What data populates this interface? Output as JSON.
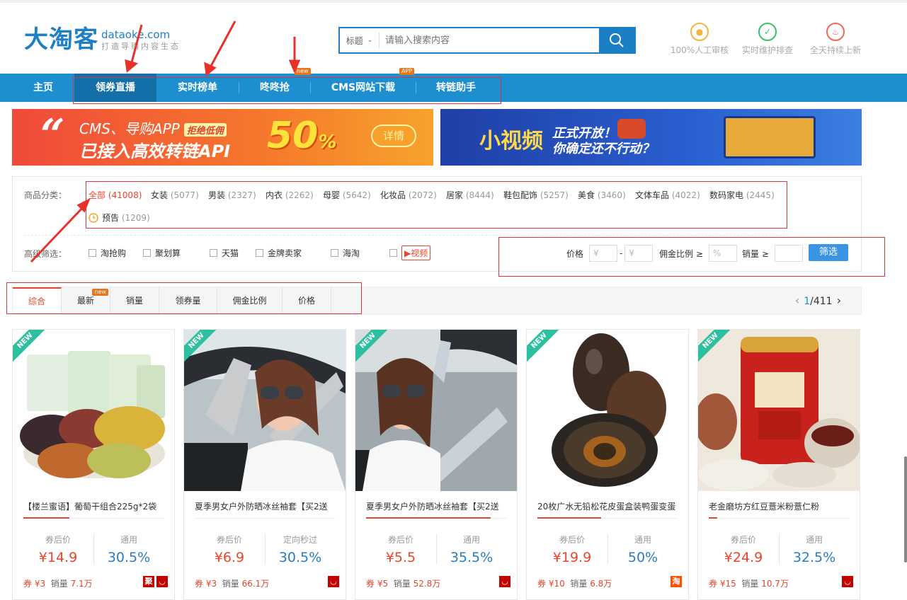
{
  "logo": {
    "cn": "大淘客",
    "en": "dataoke.com",
    "slogan": "打造导购内容生态"
  },
  "search": {
    "category": "标题",
    "placeholder": "请输入搜索内容"
  },
  "badges": [
    {
      "label": "100%人工审核",
      "icon": "person-icon",
      "color": "#f5b342"
    },
    {
      "label": "实时维护排查",
      "icon": "shield-check-icon",
      "color": "#3cbf6a"
    },
    {
      "label": "全天持续上新",
      "icon": "flame-icon",
      "color": "#ef6a55"
    }
  ],
  "nav": {
    "items": [
      "主页",
      "领券直播",
      "实时榜单",
      "咚咚抢",
      "CMS网站下载",
      "转链助手"
    ],
    "tag_new": "new",
    "tag_app": "APP"
  },
  "banner1": {
    "line1": "CMS、导购APP",
    "tag": "拒绝低佣",
    "line2": "已接入高效转链API",
    "percent": "50",
    "percent_sign": "%",
    "button": "详情"
  },
  "banner2": {
    "title": "小视频",
    "sub1": "正式开放！",
    "sub2": "你确定还不行动？"
  },
  "filter": {
    "category_label": "商品分类：",
    "categories": [
      {
        "name": "全部",
        "count": "(41008)"
      },
      {
        "name": "女装",
        "count": "(5077)"
      },
      {
        "name": "男装",
        "count": "(2327)"
      },
      {
        "name": "内衣",
        "count": "(2262)"
      },
      {
        "name": "母婴",
        "count": "(5642)"
      },
      {
        "name": "化妆品",
        "count": "(2072)"
      },
      {
        "name": "居家",
        "count": "(8444)"
      },
      {
        "name": "鞋包配饰",
        "count": "(5257)"
      },
      {
        "name": "美食",
        "count": "(3460)"
      },
      {
        "name": "文体车品",
        "count": "(4022)"
      },
      {
        "name": "数码家电",
        "count": "(2445)"
      },
      {
        "name": "预告",
        "count": "(1209)"
      }
    ],
    "advanced_label": "高级筛选：",
    "checks": [
      "淘抢购",
      "聚划算",
      "天猫",
      "金牌卖家",
      "海淘",
      "视频"
    ],
    "price_label": "价格",
    "currency": "¥",
    "dash": "-",
    "commission_label": "佣金比例 ≥",
    "percent": "%",
    "sales_label": "销量 ≥",
    "button": "筛选"
  },
  "sort": {
    "tabs": [
      "综合",
      "最新",
      "销量",
      "领券量",
      "佣金比例",
      "价格"
    ],
    "new_tag": "new",
    "page_current": "1",
    "page_total": "/411"
  },
  "products": [
    {
      "title": "【楼兰蜜语】葡萄干组合225g*2袋",
      "price_label": "券后价",
      "price": "¥14.9",
      "rate_label": "通用",
      "rate": "30.5%",
      "coupon": "券 ¥3",
      "sales_label": "销量",
      "sales": "7.1万",
      "shops": [
        "聚",
        "天"
      ]
    },
    {
      "title": "夏季男女户外防晒冰丝袖套【买2送",
      "price_label": "券后价",
      "price": "¥6.9",
      "rate_label": "定向秒过",
      "rate": "30.5%",
      "coupon": "券 ¥3",
      "sales_label": "销量",
      "sales": "66.1万",
      "shops": [
        "天"
      ]
    },
    {
      "title": "夏季男女户外防晒冰丝袖套【买2送",
      "price_label": "券后价",
      "price": "¥5.5",
      "rate_label": "通用",
      "rate": "35.5%",
      "coupon": "券 ¥5",
      "sales_label": "销量",
      "sales": "52.8万",
      "shops": [
        "天"
      ]
    },
    {
      "title": "20枚广水无铅松花皮蛋盒装鸭蛋变蛋",
      "price_label": "券后价",
      "price": "¥19.9",
      "rate_label": "通用",
      "rate": "50%",
      "coupon": "券 ¥10",
      "sales_label": "销量",
      "sales": "6.8万",
      "shops": [
        "淘"
      ]
    },
    {
      "title": "老金磨坊方红豆薏米粉薏仁粉",
      "price_label": "券后价",
      "price": "¥24.9",
      "rate_label": "通用",
      "rate": "32.5%",
      "coupon": "券 ¥15",
      "sales_label": "销量",
      "sales": "10.7万",
      "shops": [
        "天"
      ]
    }
  ],
  "new_badge": "NEW",
  "colors": {
    "brand_blue": "#1d8fd1",
    "accent_red": "#e8452a",
    "tmall_red": "#c40000",
    "taobao_orange": "#ff5000"
  }
}
